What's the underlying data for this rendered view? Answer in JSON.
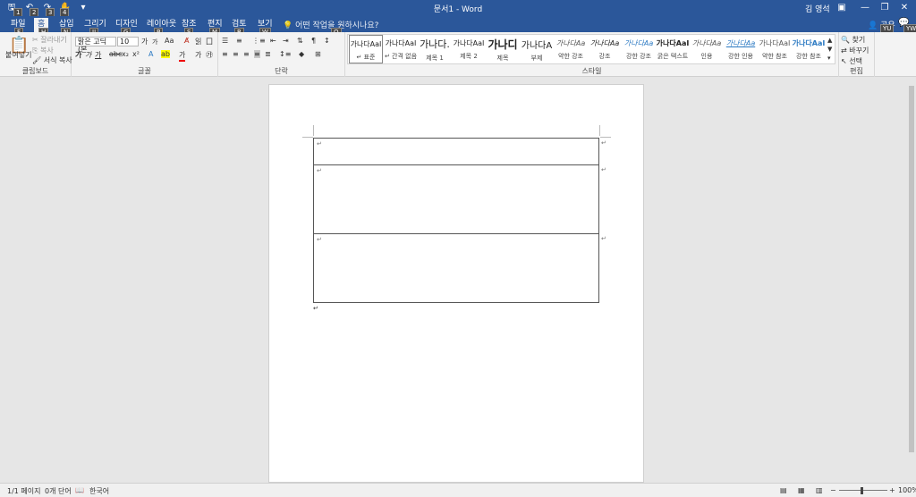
{
  "titlebar": {
    "doc_title": "문서1  -  Word",
    "user_name": "김 영석",
    "qat_keytips": [
      "1",
      "2",
      "3",
      "4"
    ]
  },
  "tabs": [
    {
      "label": "파일",
      "keytip": "F"
    },
    {
      "label": "홈",
      "keytip": "H"
    },
    {
      "label": "삽입",
      "keytip": "N"
    },
    {
      "label": "그리기",
      "keytip": "JI"
    },
    {
      "label": "디자인",
      "keytip": "G"
    },
    {
      "label": "레이아웃",
      "keytip": "P"
    },
    {
      "label": "참조",
      "keytip": "S"
    },
    {
      "label": "편지",
      "keytip": "M"
    },
    {
      "label": "검토",
      "keytip": "R"
    },
    {
      "label": "보기",
      "keytip": "W"
    }
  ],
  "tell_me": "어떤 작업을 원하시나요?",
  "tell_keytip": "Q",
  "share_label": "공유",
  "share_keytip": "YU",
  "comment_keytip": "YW",
  "clipboard": {
    "paste_label": "붙여넣기",
    "cut_label": "잘라내기",
    "copy_label": "복사",
    "format_painter_label": "서식 복사",
    "group_label": "클립보드"
  },
  "font": {
    "font_name": "맑은 고딕(본",
    "font_size": "10",
    "grow": "가",
    "shrink": "가",
    "case_label": "Aa",
    "group_label": "글꼴"
  },
  "paragraph": {
    "group_label": "단락"
  },
  "styles": {
    "group_label": "스타일",
    "items": [
      {
        "preview": "가나다AaI",
        "name": "↵ 표준"
      },
      {
        "preview": "가나다AaI",
        "name": "↵ 간격 없음"
      },
      {
        "preview": "가나다.",
        "name": "제목 1"
      },
      {
        "preview": "가나다AaI",
        "name": "제목 2"
      },
      {
        "preview": "가나디",
        "name": "제목"
      },
      {
        "preview": "가나다A",
        "name": "부제"
      },
      {
        "preview": "가나다Aa",
        "name": "약한 강조"
      },
      {
        "preview": "가나다Aa",
        "name": "강조"
      },
      {
        "preview": "가나다Aa",
        "name": "강한 강조"
      },
      {
        "preview": "가나다AaI",
        "name": "굵은 텍스트"
      },
      {
        "preview": "가나다Aa",
        "name": "인용"
      },
      {
        "preview": "가나다Aa",
        "name": "강한 인용"
      },
      {
        "preview": "가나다AaI",
        "name": "약한 참조"
      },
      {
        "preview": "가나다AaI",
        "name": "강한 참조"
      }
    ]
  },
  "editing": {
    "find_label": "찾기",
    "replace_label": "바꾸기",
    "select_label": "선택",
    "group_label": "편집"
  },
  "status": {
    "page": "1/1 페이지",
    "words": "0개 단어",
    "language": "한국어",
    "zoom": "100%"
  },
  "colors": {
    "title_bar": "#2b579a"
  }
}
